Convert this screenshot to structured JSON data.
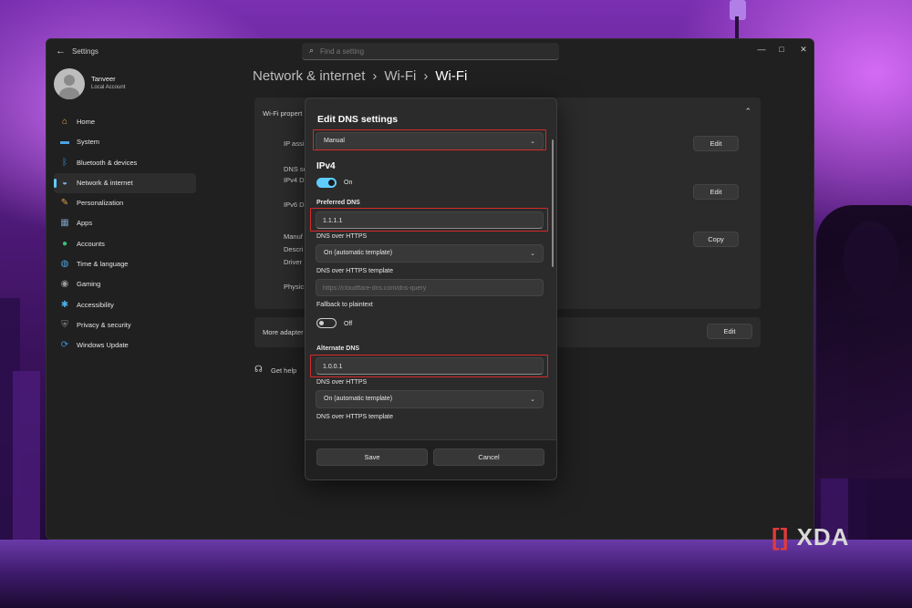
{
  "window": {
    "app_title": "Settings",
    "back_icon": "back-arrow-icon",
    "search_placeholder": "Find a setting",
    "controls": {
      "minimize": "—",
      "maximize": "□",
      "close": "✕"
    }
  },
  "profile": {
    "name": "Tanveer",
    "account_type": "Local Account"
  },
  "nav": [
    {
      "label": "Home",
      "icon": "home-icon",
      "color": "#e0a84a",
      "glyph": "⌂"
    },
    {
      "label": "System",
      "icon": "system-icon",
      "color": "#4aa3e0",
      "glyph": "▬"
    },
    {
      "label": "Bluetooth & devices",
      "icon": "bluetooth-icon",
      "color": "#3b8fe0",
      "glyph": "ᛒ"
    },
    {
      "label": "Network & internet",
      "icon": "wifi-icon",
      "color": "#7fb3e8",
      "glyph": "◒"
    },
    {
      "label": "Personalization",
      "icon": "brush-icon",
      "color": "#e0a04a",
      "glyph": "✎"
    },
    {
      "label": "Apps",
      "icon": "apps-icon",
      "color": "#7a9ab8",
      "glyph": "▦"
    },
    {
      "label": "Accounts",
      "icon": "accounts-icon",
      "color": "#3fbf7a",
      "glyph": "●"
    },
    {
      "label": "Time & language",
      "icon": "globe-icon",
      "color": "#4aa3e0",
      "glyph": "◍"
    },
    {
      "label": "Gaming",
      "icon": "gamepad-icon",
      "color": "#9a9a9a",
      "glyph": "◉"
    },
    {
      "label": "Accessibility",
      "icon": "accessibility-icon",
      "color": "#4ab0e8",
      "glyph": "✱"
    },
    {
      "label": "Privacy & security",
      "icon": "shield-icon",
      "color": "#8a8a8a",
      "glyph": "⛨"
    },
    {
      "label": "Windows Update",
      "icon": "update-icon",
      "color": "#3b8fe0",
      "glyph": "⟳"
    }
  ],
  "active_nav": "Network & internet",
  "breadcrumb": {
    "part1": "Network & internet",
    "part2": "Wi-Fi",
    "current": "Wi-Fi",
    "sep": "›"
  },
  "properties_card": {
    "title": "Wi-Fi propert",
    "rows": [
      "IP assi",
      "DNS se",
      "IPv4 D",
      "IPv6 D",
      "Manuf",
      "Descri",
      "Driver",
      "Physic"
    ],
    "buttons": [
      "Edit",
      "Edit",
      "Copy"
    ]
  },
  "more_card": {
    "label": "More adapter",
    "button": "Edit"
  },
  "get_help": "Get help",
  "dialog": {
    "title": "Edit DNS settings",
    "mode": "Manual",
    "section": "IPv4",
    "ipv4_toggle_label": "On",
    "preferred_dns_label": "Preferred DNS",
    "preferred_dns_value": "1.1.1.1",
    "doh_label": "DNS over HTTPS",
    "doh_value": "On (automatic template)",
    "doh_template_label": "DNS over HTTPS template",
    "doh_template_placeholder": "https://cloudflare-dns.com/dns-query",
    "fallback_label": "Fallback to plaintext",
    "fallback_toggle_label": "Off",
    "alternate_dns_label": "Alternate DNS",
    "alternate_dns_value": "1.0.0.1",
    "doh2_label": "DNS over HTTPS",
    "doh2_value": "On (automatic template)",
    "doh2_template_label": "DNS over HTTPS template",
    "save": "Save",
    "cancel": "Cancel"
  },
  "watermark": {
    "bracket": "[]",
    "text": "XDA"
  },
  "colors": {
    "accent": "#60cdff",
    "highlight": "#d62a2a",
    "window_bg": "#202020"
  }
}
